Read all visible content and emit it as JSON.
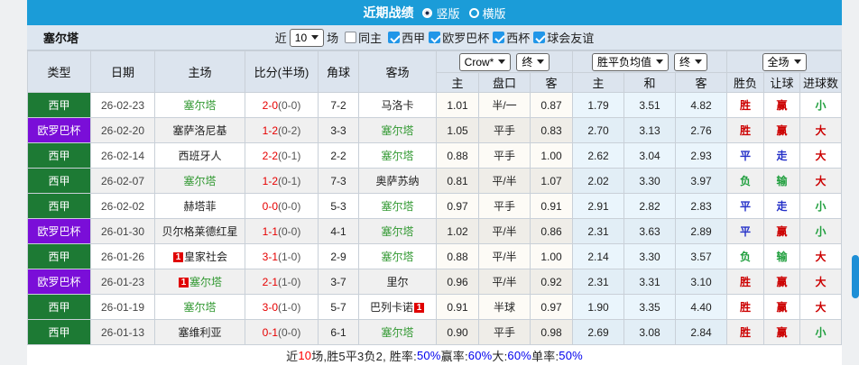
{
  "colors": {
    "title_bar_blue": "#1B9CD8",
    "league_green": "#1D7A34",
    "league_purple": "#7A0ED8",
    "focus_team_green": "#339933",
    "score_red": "#E60000",
    "result_win_red": "#CC0000",
    "result_draw_blue": "#2430C8",
    "result_lose_green": "#1E9E3C",
    "summary_percent_blue": "#0000EE",
    "summary_count_red": "#FF0000",
    "scrollbar_blue": "#1E8FD6"
  },
  "title_bar": {
    "title": "近期战绩",
    "options": [
      {
        "label": "竖版",
        "selected": true
      },
      {
        "label": "横版",
        "selected": false
      }
    ]
  },
  "filter_bar": {
    "team": "塞尔塔",
    "near": "近",
    "count": "10",
    "unit": "场",
    "same_home": {
      "label": "同主",
      "checked": false
    },
    "leagues": [
      {
        "label": "西甲",
        "checked": true
      },
      {
        "label": "欧罗巴杯",
        "checked": true
      },
      {
        "label": "西杯",
        "checked": true
      },
      {
        "label": "球会友谊",
        "checked": true
      }
    ]
  },
  "table": {
    "main_headers": [
      "类型",
      "日期",
      "主场",
      "比分(半场)",
      "角球",
      "客场"
    ],
    "group_selects": {
      "crown": [
        "Crow*",
        "终"
      ],
      "avg": [
        "胜平负均值",
        "终"
      ],
      "scope": [
        "全场"
      ]
    },
    "sub_headers": [
      "主",
      "盘口",
      "客",
      "主",
      "和",
      "客",
      "胜负",
      "让球",
      "进球数"
    ],
    "rows": [
      {
        "league": "西甲",
        "league_color": "green",
        "date": "26-02-23",
        "home": "塞尔塔",
        "home_focus": true,
        "home_card": "",
        "score": "2-0",
        "half": "(0-0)",
        "corner": "7-2",
        "away": "马洛卡",
        "away_focus": false,
        "away_card": "",
        "odds": [
          "1.01",
          "半/一",
          "0.87"
        ],
        "avg": [
          "1.79",
          "3.51",
          "4.82"
        ],
        "results": [
          {
            "t": "胜",
            "c": "red"
          },
          {
            "t": "赢",
            "c": "red"
          },
          {
            "t": "小",
            "c": "green"
          }
        ]
      },
      {
        "league": "欧罗巴杯",
        "league_color": "purple",
        "date": "26-02-20",
        "home": "塞萨洛尼基",
        "home_focus": false,
        "home_card": "",
        "score": "1-2",
        "half": "(0-2)",
        "corner": "3-3",
        "away": "塞尔塔",
        "away_focus": true,
        "away_card": "",
        "odds": [
          "1.05",
          "平手",
          "0.83"
        ],
        "avg": [
          "2.70",
          "3.13",
          "2.76"
        ],
        "results": [
          {
            "t": "胜",
            "c": "red"
          },
          {
            "t": "赢",
            "c": "red"
          },
          {
            "t": "大",
            "c": "red"
          }
        ]
      },
      {
        "league": "西甲",
        "league_color": "green",
        "date": "26-02-14",
        "home": "西班牙人",
        "home_focus": false,
        "home_card": "",
        "score": "2-2",
        "half": "(0-1)",
        "corner": "2-2",
        "away": "塞尔塔",
        "away_focus": true,
        "away_card": "",
        "odds": [
          "0.88",
          "平手",
          "1.00"
        ],
        "avg": [
          "2.62",
          "3.04",
          "2.93"
        ],
        "results": [
          {
            "t": "平",
            "c": "blue"
          },
          {
            "t": "走",
            "c": "blue"
          },
          {
            "t": "大",
            "c": "red"
          }
        ]
      },
      {
        "league": "西甲",
        "league_color": "green",
        "date": "26-02-07",
        "home": "塞尔塔",
        "home_focus": true,
        "home_card": "",
        "score": "1-2",
        "half": "(0-1)",
        "corner": "7-3",
        "away": "奥萨苏纳",
        "away_focus": false,
        "away_card": "",
        "odds": [
          "0.81",
          "平/半",
          "1.07"
        ],
        "avg": [
          "2.02",
          "3.30",
          "3.97"
        ],
        "results": [
          {
            "t": "负",
            "c": "green"
          },
          {
            "t": "输",
            "c": "green"
          },
          {
            "t": "大",
            "c": "red"
          }
        ]
      },
      {
        "league": "西甲",
        "league_color": "green",
        "date": "26-02-02",
        "home": "赫塔菲",
        "home_focus": false,
        "home_card": "",
        "score": "0-0",
        "half": "(0-0)",
        "corner": "5-3",
        "away": "塞尔塔",
        "away_focus": true,
        "away_card": "",
        "odds": [
          "0.97",
          "平手",
          "0.91"
        ],
        "avg": [
          "2.91",
          "2.82",
          "2.83"
        ],
        "results": [
          {
            "t": "平",
            "c": "blue"
          },
          {
            "t": "走",
            "c": "blue"
          },
          {
            "t": "小",
            "c": "green"
          }
        ]
      },
      {
        "league": "欧罗巴杯",
        "league_color": "purple",
        "date": "26-01-30",
        "home": "贝尔格莱德红星",
        "home_focus": false,
        "home_card": "",
        "score": "1-1",
        "half": "(0-0)",
        "corner": "4-1",
        "away": "塞尔塔",
        "away_focus": true,
        "away_card": "",
        "odds": [
          "1.02",
          "平/半",
          "0.86"
        ],
        "avg": [
          "2.31",
          "3.63",
          "2.89"
        ],
        "results": [
          {
            "t": "平",
            "c": "blue"
          },
          {
            "t": "赢",
            "c": "red"
          },
          {
            "t": "小",
            "c": "green"
          }
        ]
      },
      {
        "league": "西甲",
        "league_color": "green",
        "date": "26-01-26",
        "home": "皇家社会",
        "home_focus": false,
        "home_card": "1",
        "score": "3-1",
        "half": "(1-0)",
        "corner": "2-9",
        "away": "塞尔塔",
        "away_focus": true,
        "away_card": "",
        "odds": [
          "0.88",
          "平/半",
          "1.00"
        ],
        "avg": [
          "2.14",
          "3.30",
          "3.57"
        ],
        "results": [
          {
            "t": "负",
            "c": "green"
          },
          {
            "t": "输",
            "c": "green"
          },
          {
            "t": "大",
            "c": "red"
          }
        ]
      },
      {
        "league": "欧罗巴杯",
        "league_color": "purple",
        "date": "26-01-23",
        "home": "塞尔塔",
        "home_focus": true,
        "home_card": "1",
        "score": "2-1",
        "half": "(1-0)",
        "corner": "3-7",
        "away": "里尔",
        "away_focus": false,
        "away_card": "",
        "odds": [
          "0.96",
          "平/半",
          "0.92"
        ],
        "avg": [
          "2.31",
          "3.31",
          "3.10"
        ],
        "results": [
          {
            "t": "胜",
            "c": "red"
          },
          {
            "t": "赢",
            "c": "red"
          },
          {
            "t": "大",
            "c": "red"
          }
        ]
      },
      {
        "league": "西甲",
        "league_color": "green",
        "date": "26-01-19",
        "home": "塞尔塔",
        "home_focus": true,
        "home_card": "",
        "score": "3-0",
        "half": "(1-0)",
        "corner": "5-7",
        "away": "巴列卡诺",
        "away_focus": false,
        "away_card": "1",
        "odds": [
          "0.91",
          "半球",
          "0.97"
        ],
        "avg": [
          "1.90",
          "3.35",
          "4.40"
        ],
        "results": [
          {
            "t": "胜",
            "c": "red"
          },
          {
            "t": "赢",
            "c": "red"
          },
          {
            "t": "大",
            "c": "red"
          }
        ]
      },
      {
        "league": "西甲",
        "league_color": "green",
        "date": "26-01-13",
        "home": "塞维利亚",
        "home_focus": false,
        "home_card": "",
        "score": "0-1",
        "half": "(0-0)",
        "corner": "6-1",
        "away": "塞尔塔",
        "away_focus": true,
        "away_card": "",
        "odds": [
          "0.90",
          "平手",
          "0.98"
        ],
        "avg": [
          "2.69",
          "3.08",
          "2.84"
        ],
        "results": [
          {
            "t": "胜",
            "c": "red"
          },
          {
            "t": "赢",
            "c": "red"
          },
          {
            "t": "小",
            "c": "green"
          }
        ]
      }
    ]
  },
  "summary": {
    "segments": [
      {
        "t": "近",
        "c": "black"
      },
      {
        "t": "10",
        "c": "red"
      },
      {
        "t": "场,胜5平3负2, 胜率:",
        "c": "black"
      },
      {
        "t": "50%",
        "c": "blue"
      },
      {
        "t": " 赢率:",
        "c": "black"
      },
      {
        "t": "60%",
        "c": "blue"
      },
      {
        "t": " 大:",
        "c": "black"
      },
      {
        "t": "60%",
        "c": "blue"
      },
      {
        "t": " 单率:",
        "c": "black"
      },
      {
        "t": "50%",
        "c": "blue"
      }
    ]
  }
}
